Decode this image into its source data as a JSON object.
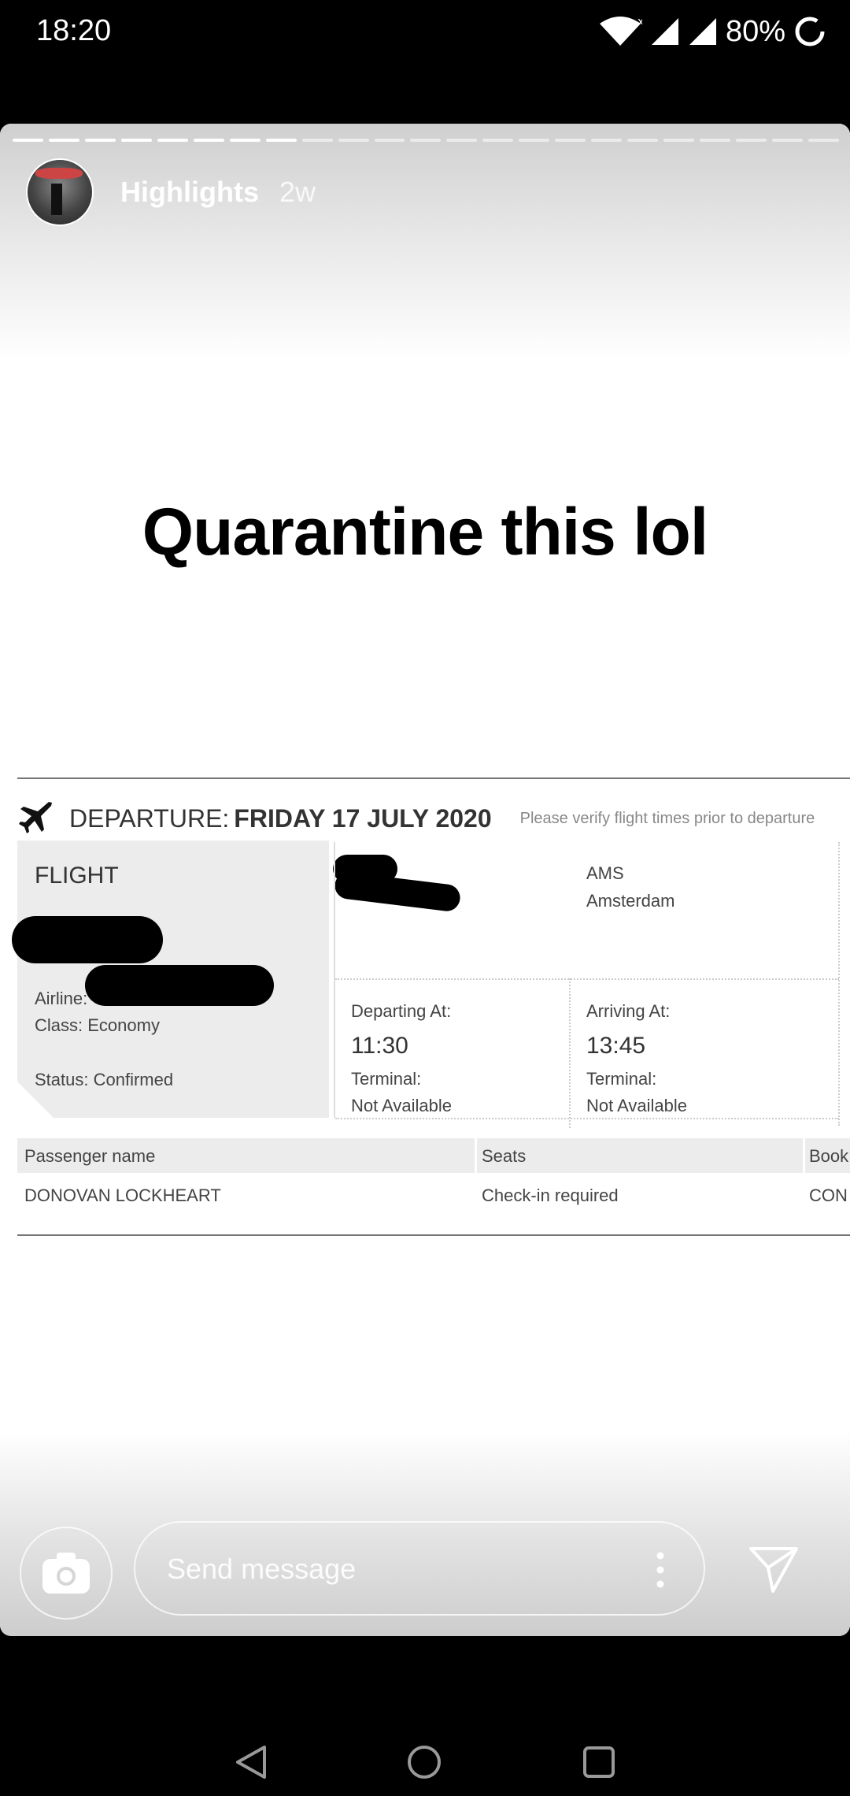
{
  "status_bar": {
    "time": "18:20",
    "battery": "80%",
    "icons": [
      "wifi-icon",
      "signal-no-data-icon",
      "signal-icon",
      "battery-saver-icon"
    ]
  },
  "story": {
    "progress": {
      "segments": 23,
      "completed": 8
    },
    "header": {
      "name": "Highlights",
      "age": "2w"
    },
    "caption": "Quarantine this lol",
    "ticket": {
      "departure_label": "DEPARTURE:",
      "departure_date": "FRIDAY 17 JULY 2020",
      "verify_note": "Please verify flight times prior to departure",
      "flight_title": "FLIGHT",
      "airline_label": "Airline:",
      "class": "Class: Economy",
      "status": "Status: Confirmed",
      "destination_code": "AMS",
      "destination_city": "Amsterdam",
      "departing_label": "Departing At:",
      "departing_time": "11:30",
      "departing_terminal_label": "Terminal:",
      "departing_terminal": "Not Available",
      "arriving_label": "Arriving At:",
      "arriving_time": "13:45",
      "arriving_terminal_label": "Terminal:",
      "arriving_terminal": "Not Available",
      "passenger_headers": [
        "Passenger name",
        "Seats",
        "Book"
      ],
      "passenger_row": [
        "DONOVAN LOCKHEART",
        "Check-in required",
        "CON"
      ]
    }
  },
  "reply": {
    "placeholder": "Send message"
  },
  "colors": {
    "background": "#000000",
    "card": "#ffffff",
    "ticket_panel": "#ececec"
  }
}
